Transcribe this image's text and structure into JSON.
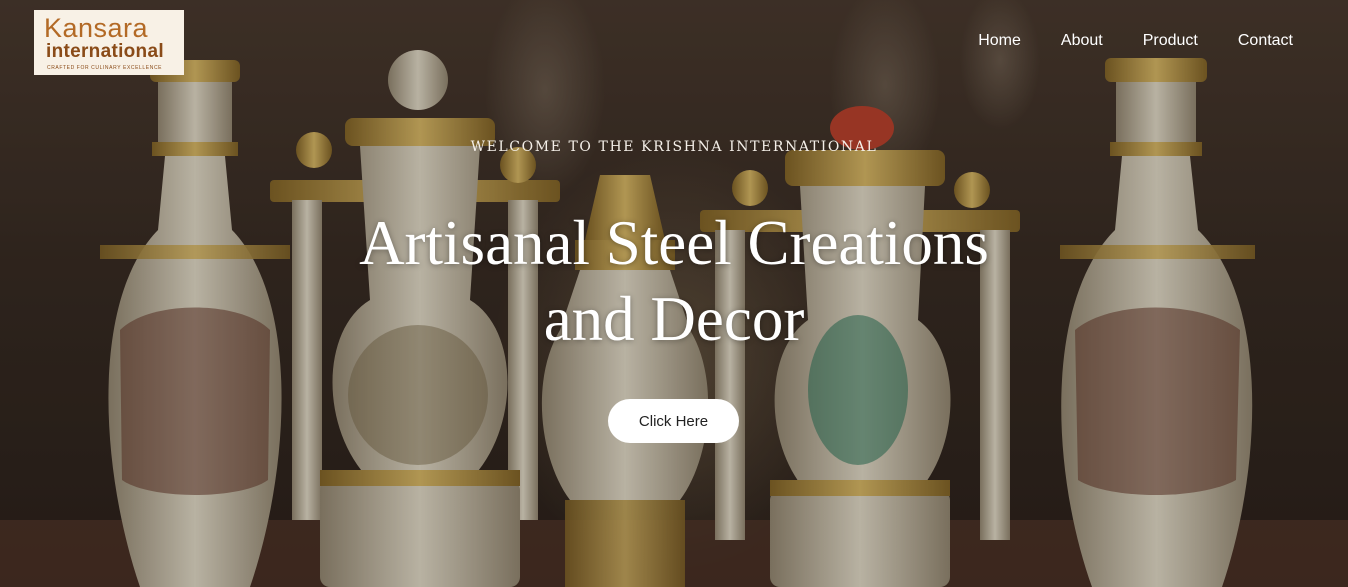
{
  "logo": {
    "line1": "Kansara",
    "line2": "international",
    "tagline": "CRAFTED FOR CULINARY EXCELLENCE"
  },
  "nav": {
    "items": [
      {
        "label": "Home"
      },
      {
        "label": "About"
      },
      {
        "label": "Product"
      },
      {
        "label": "Contact"
      }
    ]
  },
  "hero": {
    "kicker": "WELCOME TO THE KRISHNA INTERNATIONAL",
    "title_line1": "Artisanal Steel Creations",
    "title_line2": "and Decor",
    "cta_label": "Click Here"
  },
  "colors": {
    "brand": "#b36a26",
    "brand_dark": "#8a4b18",
    "gold": "#c9a24a",
    "ivory": "#e9e2cf",
    "button_bg": "#ffffff"
  }
}
